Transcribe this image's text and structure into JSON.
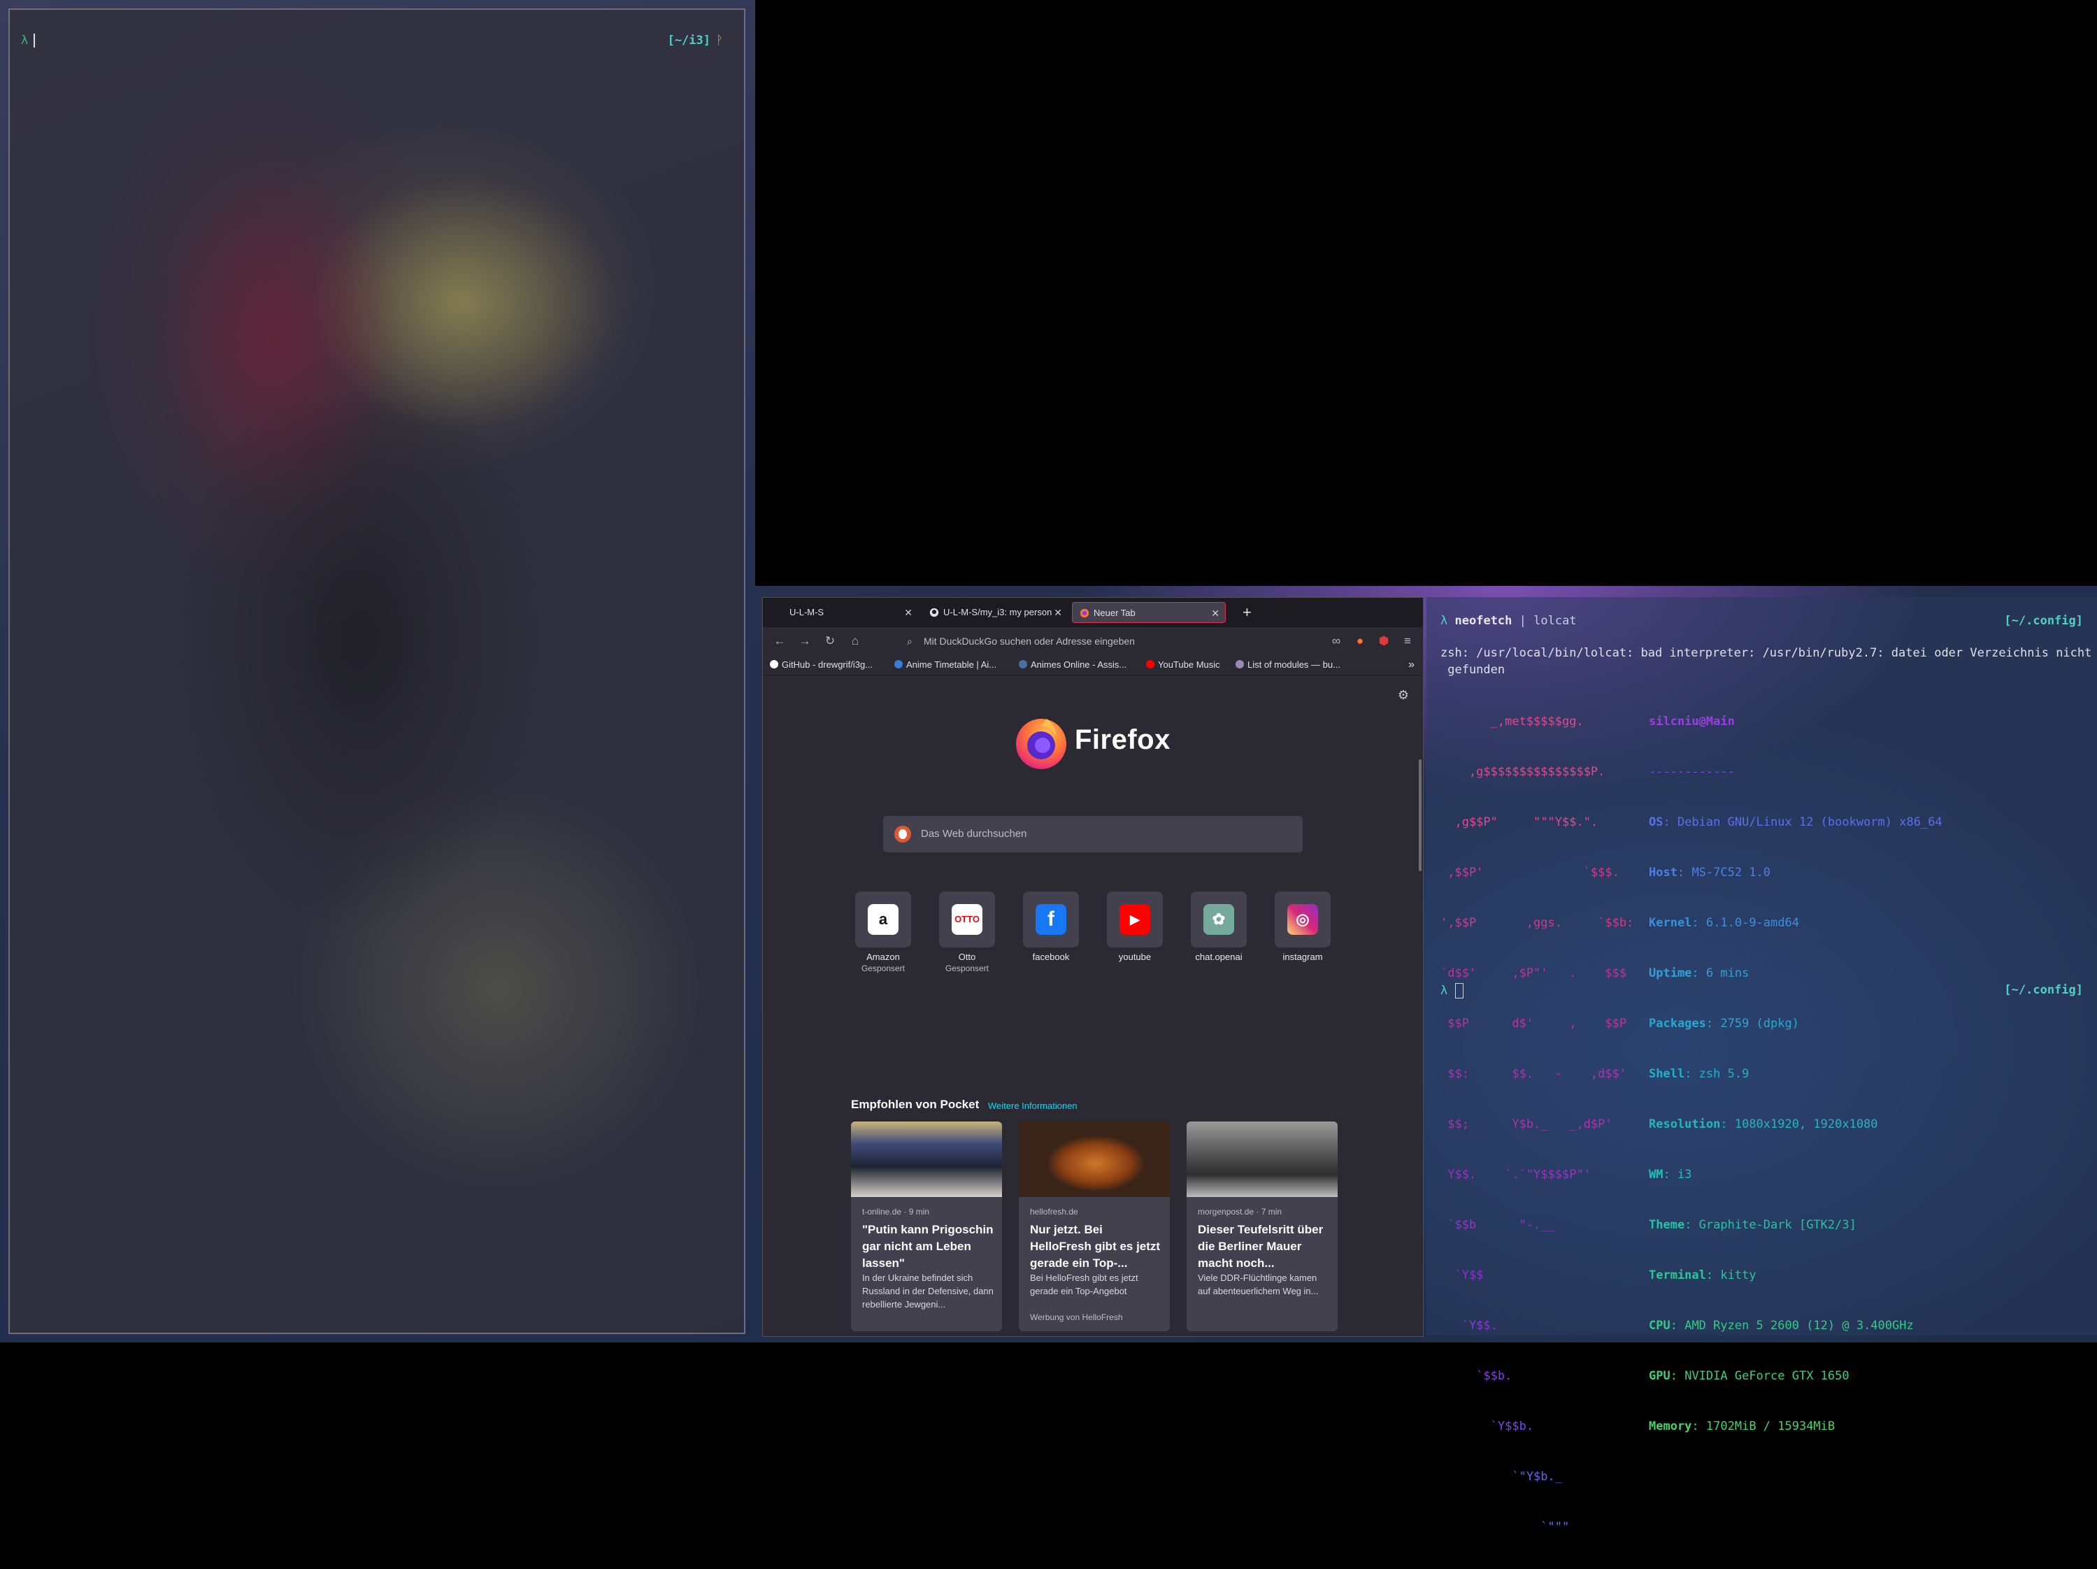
{
  "left_terminal": {
    "prompt_symbol": "λ",
    "cwd": "[~/i3]",
    "git_symbol": "ᚹ"
  },
  "firefox": {
    "tabs": [
      {
        "title": "U-L-M-S",
        "active": false
      },
      {
        "title": "U-L-M-S/my_i3: my person",
        "active": false
      },
      {
        "title": "Neuer Tab",
        "active": true
      }
    ],
    "new_tab": "+",
    "urlbar_placeholder": "Mit DuckDuckGo suchen oder Adresse eingeben",
    "bookmarks": [
      {
        "label": "GitHub - drewgrif/i3g...",
        "icon_color": "#ffffff"
      },
      {
        "label": "Anime Timetable | Ai...",
        "icon_color": "#3a7bd5"
      },
      {
        "label": "Animes Online - Assis...",
        "icon_color": "#4a6fa5"
      },
      {
        "label": "YouTube Music",
        "icon_color": "#ff0000"
      },
      {
        "label": "List of modules — bu...",
        "icon_color": "#9b8ab8"
      }
    ],
    "bookmarks_overflow": "»",
    "brand": "Firefox",
    "search_placeholder": "Das Web durchsuchen",
    "shortcuts": [
      {
        "name": "Amazon",
        "sub": "Gesponsert",
        "glyph": "a",
        "bg": "#ffffff",
        "fg": "#111111"
      },
      {
        "name": "Otto",
        "sub": "Gesponsert",
        "glyph": "OTTO",
        "bg": "#ffffff",
        "fg": "#e30613"
      },
      {
        "name": "facebook",
        "sub": "",
        "glyph": "f",
        "bg": "#1877f2",
        "fg": "#ffffff"
      },
      {
        "name": "youtube",
        "sub": "",
        "glyph": "▶",
        "bg": "#ff0000",
        "fg": "#ffffff"
      },
      {
        "name": "chat.openai",
        "sub": "",
        "glyph": "✿",
        "bg": "#74aa9c",
        "fg": "#ffffff"
      },
      {
        "name": "instagram",
        "sub": "",
        "glyph": "◎",
        "bg": "#d6249f",
        "fg": "#ffffff"
      }
    ],
    "pocket": {
      "heading": "Empfohlen von Pocket",
      "more": "Weitere Informationen",
      "cards": [
        {
          "source": "t-online.de · 9 min",
          "title": "\"Putin kann Prigoschin gar nicht am Leben lassen\"",
          "excerpt": "In der Ukraine befindet sich Russland in der Defensive, dann rebellierte Jewgeni...",
          "sponsor": ""
        },
        {
          "source": "hellofresh.de",
          "title": "Nur jetzt. Bei HelloFresh gibt es jetzt gerade ein Top-...",
          "excerpt": "Bei HelloFresh gibt es jetzt gerade ein Top-Angebot",
          "sponsor": "Werbung von HelloFresh"
        },
        {
          "source": "morgenpost.de · 7 min",
          "title": "Dieser Teufelsritt über die Berliner Mauer macht noch...",
          "excerpt": "Viele DDR-Flüchtlinge kamen auf abenteuerlichem Weg in...",
          "sponsor": ""
        }
      ]
    }
  },
  "right_terminal": {
    "cmd_prompt": "λ",
    "cmd_1": "neofetch",
    "cmd_pipe": "|",
    "cmd_2": "lolcat",
    "cwd": "[~/.config]",
    "error_1": "zsh: /usr/local/bin/lolcat: bad interpreter: /usr/bin/ruby2.7: datei oder Verzeichnis nicht",
    "error_2": " gefunden",
    "ascii_art": [
      "       _,met$$$$$gg.",
      "    ,g$$$$$$$$$$$$$$$P.",
      "  ,g$$P\"     \"\"\"Y$$.\".",
      " ,$$P'              `$$$.",
      "',$$P       ,ggs.     `$$b:",
      "`d$$'     ,$P\"'   .    $$$",
      " $$P      d$'     ,    $$P",
      " $$:      $$.   -    ,d$$'",
      " $$;      Y$b._   _,d$P'",
      " Y$$.    `.`\"Y$$$$P\"'",
      " `$$b      \"-.__",
      "  `Y$$",
      "   `Y$$.",
      "     `$$b.",
      "       `Y$$b.",
      "          `\"Y$b._",
      "              `\"\"\""
    ],
    "info_header": "silcniu@Main",
    "info_sep": "------------",
    "info": [
      {
        "k": "OS",
        "v": "Debian GNU/Linux 12 (bookworm) x86_64"
      },
      {
        "k": "Host",
        "v": "MS-7C52 1.0"
      },
      {
        "k": "Kernel",
        "v": "6.1.0-9-amd64"
      },
      {
        "k": "Uptime",
        "v": "6 mins"
      },
      {
        "k": "Packages",
        "v": "2759 (dpkg)"
      },
      {
        "k": "Shell",
        "v": "zsh 5.9"
      },
      {
        "k": "Resolution",
        "v": "1080x1920, 1920x1080"
      },
      {
        "k": "WM",
        "v": "i3"
      },
      {
        "k": "Theme",
        "v": "Graphite-Dark [GTK2/3]"
      },
      {
        "k": "Terminal",
        "v": "kitty"
      },
      {
        "k": "CPU",
        "v": "AMD Ryzen 5 2600 (12) @ 3.400GHz"
      },
      {
        "k": "GPU",
        "v": "NVIDIA GeForce GTX 1650"
      },
      {
        "k": "Memory",
        "v": "1702MiB / 15934MiB"
      }
    ],
    "prompt2": "λ",
    "cwd2": "[~/.config]"
  },
  "colors": {
    "accent_red": "#e22850",
    "pocket_link": "#00ddff",
    "prompt_green": "#37b47c",
    "cwd_cyan": "#4fd1c5"
  }
}
